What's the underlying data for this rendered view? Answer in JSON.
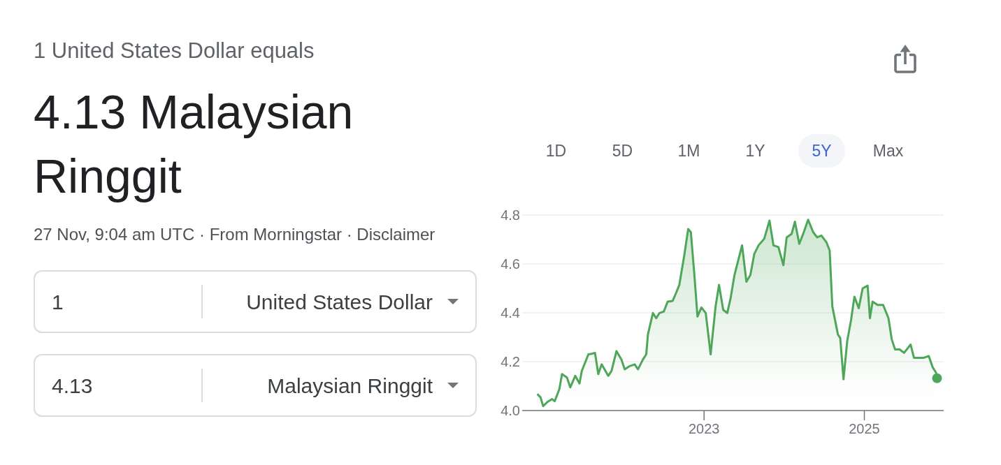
{
  "header": {
    "subtitle": "1 United States Dollar equals",
    "result": "4.13 Malaysian Ringgit",
    "meta": "27 Nov, 9:04 am UTC · From Morningstar · Disclaimer"
  },
  "converter": [
    {
      "amount": "1",
      "currency": "United States Dollar"
    },
    {
      "amount": "4.13",
      "currency": "Malaysian Ringgit"
    }
  ],
  "range_tabs": [
    {
      "label": "1D",
      "selected": false
    },
    {
      "label": "5D",
      "selected": false
    },
    {
      "label": "1M",
      "selected": false
    },
    {
      "label": "1Y",
      "selected": false
    },
    {
      "label": "5Y",
      "selected": true
    },
    {
      "label": "Max",
      "selected": false
    }
  ],
  "chart": {
    "chart_data": {
      "type": "area",
      "grid": true,
      "x": [
        2020.918,
        2020.959,
        2020.992,
        2021.041,
        2021.103,
        2021.136,
        2021.194,
        2021.227,
        2021.289,
        2021.33,
        2021.392,
        2021.445,
        2021.474,
        2021.557,
        2021.598,
        2021.639,
        2021.68,
        2021.722,
        2021.804,
        2021.845,
        2021.907,
        2021.969,
        2022.01,
        2022.072,
        2022.134,
        2022.175,
        2022.237,
        2022.278,
        2022.299,
        2022.361,
        2022.402,
        2022.443,
        2022.497,
        2022.546,
        2022.608,
        2022.649,
        2022.691,
        2022.753,
        2022.802,
        2022.835,
        2022.876,
        2022.918,
        2022.967,
        2023.021,
        2023.082,
        2023.144,
        2023.186,
        2023.239,
        2023.289,
        2023.33,
        2023.379,
        2023.421,
        2023.474,
        2023.528,
        2023.577,
        2023.627,
        2023.68,
        2023.751,
        2023.816,
        2023.866,
        2023.928,
        2023.99,
        2024.031,
        2024.093,
        2024.134,
        2024.188,
        2024.237,
        2024.299,
        2024.361,
        2024.41,
        2024.464,
        2024.526,
        2024.567,
        2024.6,
        2024.67,
        2024.699,
        2024.74,
        2024.786,
        2024.835,
        2024.876,
        2024.93,
        2024.979,
        2025.041,
        2025.07,
        2025.103,
        2025.165,
        2025.235,
        2025.301,
        2025.342,
        2025.384,
        2025.441,
        2025.495,
        2025.577,
        2025.619,
        2025.68,
        2025.742,
        2025.804,
        2025.854,
        2025.895,
        2025.907
      ],
      "values": [
        4.068,
        4.054,
        4.018,
        4.034,
        4.047,
        4.038,
        4.088,
        4.149,
        4.135,
        4.095,
        4.142,
        4.111,
        4.162,
        4.23,
        4.232,
        4.236,
        4.149,
        4.189,
        4.142,
        4.162,
        4.243,
        4.209,
        4.169,
        4.182,
        4.189,
        4.169,
        4.209,
        4.23,
        4.311,
        4.399,
        4.378,
        4.399,
        4.405,
        4.446,
        4.449,
        4.48,
        4.514,
        4.635,
        4.743,
        4.73,
        4.568,
        4.385,
        4.422,
        4.399,
        4.23,
        4.426,
        4.514,
        4.412,
        4.399,
        4.459,
        4.554,
        4.608,
        4.676,
        4.527,
        4.554,
        4.641,
        4.676,
        4.703,
        4.777,
        4.676,
        4.669,
        4.595,
        4.709,
        4.723,
        4.773,
        4.682,
        4.723,
        4.781,
        4.73,
        4.709,
        4.716,
        4.689,
        4.655,
        4.426,
        4.311,
        4.297,
        4.128,
        4.284,
        4.372,
        4.466,
        4.419,
        4.5,
        4.511,
        4.378,
        4.446,
        4.432,
        4.432,
        4.378,
        4.291,
        4.25,
        4.25,
        4.236,
        4.27,
        4.216,
        4.216,
        4.216,
        4.223,
        4.176,
        4.155,
        4.132
      ],
      "xlim": [
        2020.73,
        2025.99
      ],
      "ylim": [
        4,
        4.8
      ],
      "xticks": [
        {
          "value": 2023,
          "label": "2023"
        },
        {
          "value": 2025,
          "label": "2025"
        }
      ],
      "yticks": [
        {
          "value": 4,
          "label": "4.0"
        },
        {
          "value": 4.2,
          "label": "4.2"
        },
        {
          "value": 4.4,
          "label": "4.4"
        },
        {
          "value": 4.6,
          "label": "4.6"
        },
        {
          "value": 4.8,
          "label": "4.8"
        }
      ]
    }
  }
}
